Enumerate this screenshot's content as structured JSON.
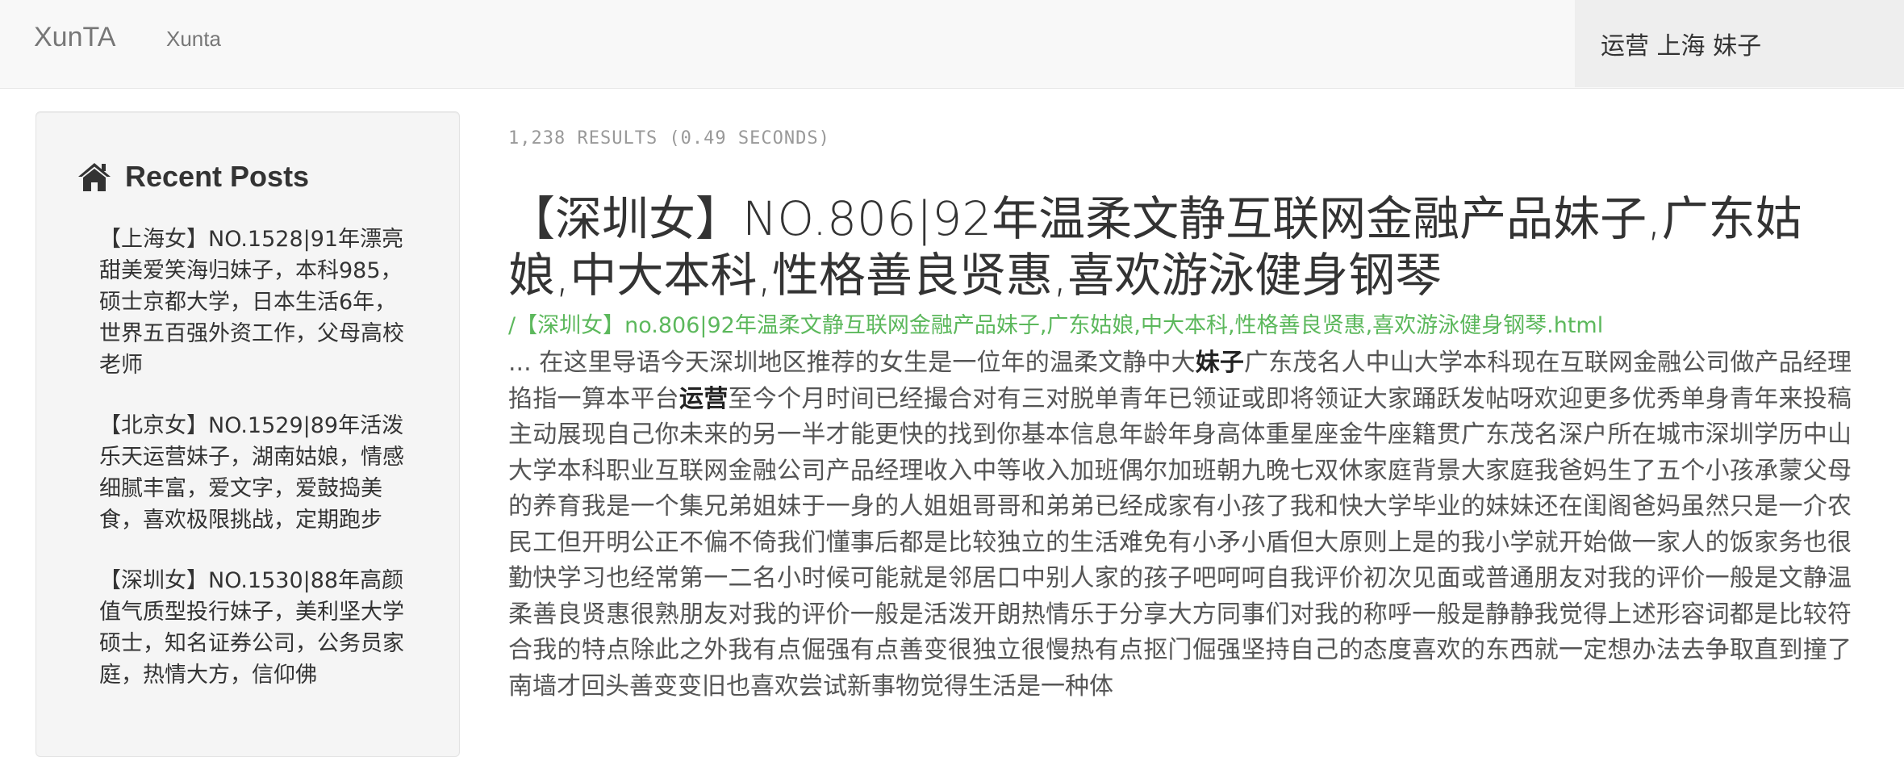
{
  "navbar": {
    "brand": "XunTA",
    "link": "Xunta",
    "search_value": "运营 上海 妹子"
  },
  "sidebar": {
    "title": "Recent Posts",
    "title_icon": "home-icon",
    "posts": [
      "【上海女】NO.1528|91年漂亮甜美爱笑海归妹子，本科985，硕士京都大学，日本生活6年，世界五百强外资工作，父母高校老师",
      "【北京女】NO.1529|89年活泼乐天运营妹子，湖南姑娘，情感细腻丰富，爱文字，爱鼓捣美食，喜欢极限挑战，定期跑步",
      "【深圳女】NO.1530|88年高颜值气质型投行妹子，美利坚大学硕士，知名证券公司，公务员家庭，热情大方，信仰佛"
    ]
  },
  "results": {
    "stats": "1,238 RESULTS (0.49 SECONDS)",
    "items": [
      {
        "title": "【深圳女】NO.806|92年温柔文静互联网金融产品妹子,广东姑娘,中大本科,性格善良贤惠,喜欢游泳健身钢琴",
        "url": "/【深圳女】no.806|92年温柔文静互联网金融产品妹子,广东姑娘,中大本科,性格善良贤惠,喜欢游泳健身钢琴.html",
        "snippet_parts": [
          "... 在这里导语今天深圳地区推荐的女生是一位年的温柔文静中大",
          "妹子",
          "广东茂名人中山大学本科现在互联网金融公司做产品经理掐指一算本平台",
          "运营",
          "至今个月时间已经撮合对有三对脱单青年已领证或即将领证大家踊跃发帖呀欢迎更多优秀单身青年来投稿主动展现自己你未来的另一半才能更快的找到你基本信息年龄年身高体重星座金牛座籍贯广东茂名深户所在城市深圳学历中山大学本科职业互联网金融公司产品经理收入中等收入加班偶尔加班朝九晚七双休家庭背景大家庭我爸妈生了五个小孩承蒙父母的养育我是一个集兄弟姐妹于一身的人姐姐哥哥和弟弟已经成家有小孩了我和快大学毕业的妹妹还在闺阁爸妈虽然只是一介农民工但开明公正不偏不倚我们懂事后都是比较独立的生活难免有小矛小盾但大原则上是的我小学就开始做一家人的饭家务也很勤快学习也经常第一二名小时候可能就是邻居口中别人家的孩子吧呵呵自我评价初次见面或普通朋友对我的评价一般是文静温柔善良贤惠很熟朋友对我的评价一般是活泼开朗热情乐于分享大方同事们对我的称呼一般是静静我觉得上述形容词都是比较符合我的特点除此之外我有点倔强有点善变很独立很慢热有点抠门倔强坚持自己的态度喜欢的东西就一定想办法去争取直到撞了南墙才回头善变变旧也喜欢尝试新事物觉得生活是一种体"
        ]
      }
    ]
  }
}
